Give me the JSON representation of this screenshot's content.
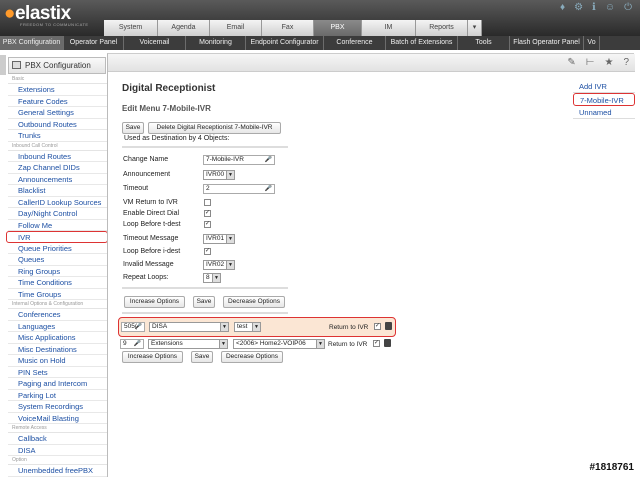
{
  "header": {
    "logo": "elastix",
    "tagline": "FREEDOM TO COMMUNICATE",
    "tabs": [
      "System",
      "Agenda",
      "Email",
      "Fax",
      "PBX",
      "IM",
      "Reports"
    ],
    "active_tab": "PBX",
    "more_icon": "chevron-down-icon",
    "icons": [
      "drop-icon",
      "gear-icon",
      "info-icon",
      "user-icon",
      "logout-icon"
    ]
  },
  "subnav": [
    "PBX Configuration",
    "Operator Panel",
    "Voicemail",
    "Monitoring",
    "Endpoint Configurator",
    "Conference",
    "Batch of Extensions",
    "Tools",
    "Flash Operator Panel",
    "Vo"
  ],
  "sidebar": {
    "title": "PBX Configuration",
    "sections": [
      {
        "category": "Basic",
        "items": [
          "Extensions",
          "Feature Codes",
          "General Settings",
          "Outbound Routes",
          "Trunks"
        ]
      },
      {
        "category": "Inbound Call Control",
        "items": [
          "Inbound Routes",
          "Zap Channel DIDs",
          "Announcements",
          "Blacklist",
          "CallerID Lookup Sources",
          "Day/Night Control",
          "Follow Me",
          "IVR",
          "Queue Priorities",
          "Queues",
          "Ring Groups",
          "Time Conditions",
          "Time Groups"
        ]
      },
      {
        "category": "Internal Options & Configuration",
        "items": [
          "Conferences",
          "Languages",
          "Misc Applications",
          "Misc Destinations",
          "Music on Hold",
          "PIN Sets",
          "Paging and Intercom",
          "Parking Lot",
          "System Recordings",
          "VoiceMail Blasting"
        ]
      },
      {
        "category": "Remote Access",
        "items": [
          "Callback",
          "DISA"
        ]
      },
      {
        "category": "Option",
        "items": [
          "Unembedded freePBX"
        ]
      }
    ],
    "selected": "IVR"
  },
  "main": {
    "title": "Digital Receptionist",
    "edit_title": "Edit Menu 7-Mobile-IVR",
    "save_label": "Save",
    "delete_label": "Delete Digital Receptionist 7-Mobile-IVR",
    "used_by": "Used as Destination by 4 Objects:",
    "form": {
      "change_name_label": "Change Name",
      "change_name_value": "7-Mobile-IVR",
      "announcement_label": "Announcement",
      "announcement_value": "IVR00",
      "timeout_label": "Timeout",
      "timeout_value": "2",
      "vm_return_label": "VM Return to IVR",
      "vm_return_checked": false,
      "direct_dial_label": "Enable Direct Dial",
      "direct_dial_checked": true,
      "loop_t_label": "Loop Before t-dest",
      "loop_t_checked": true,
      "timeout_msg_label": "Timeout Message",
      "timeout_msg_value": "IVR01",
      "loop_i_label": "Loop Before i-dest",
      "loop_i_checked": true,
      "invalid_msg_label": "Invalid Message",
      "invalid_msg_value": "IVR02",
      "repeat_label": "Repeat Loops:",
      "repeat_value": "8"
    },
    "increase_label": "Increase Options",
    "decrease_label": "Decrease Options",
    "entries": [
      {
        "digits": "505(",
        "type": "DISA",
        "dest": "test",
        "return_label": "Return to IVR",
        "checked": true
      },
      {
        "digits": "9",
        "type": "Extensions",
        "dest": "<2006> Home2-VOIP06",
        "return_label": "Return to IVR",
        "checked": true
      }
    ]
  },
  "right_panel": {
    "items": [
      "Add IVR",
      "7-Mobile-IVR",
      "Unnamed"
    ],
    "selected": "7-Mobile-IVR"
  },
  "watermark": "#1818761"
}
